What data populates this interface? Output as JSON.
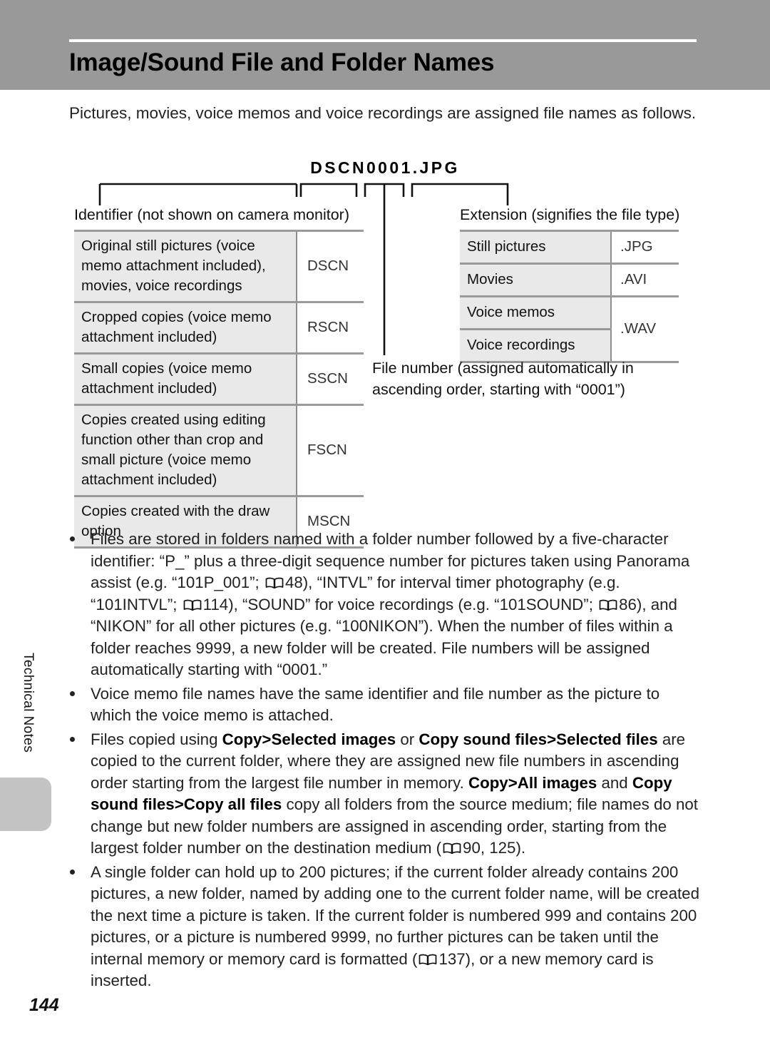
{
  "header": {
    "title": "Image/Sound File and Folder Names"
  },
  "intro": "Pictures, movies, voice memos and voice recordings are assigned file names as follows.",
  "filename_example": "DSCN0001.JPG",
  "captions": {
    "identifier": "Identifier (not shown on camera monitor)",
    "extension": "Extension (signifies the file type)",
    "file_number": "File number (assigned automatically in ascending order, starting with “0001”)"
  },
  "identifier_table": {
    "rows": [
      {
        "desc": "Original still pictures (voice memo attachment included), movies, voice recordings",
        "code": "DSCN"
      },
      {
        "desc": "Cropped copies (voice memo attachment included)",
        "code": "RSCN"
      },
      {
        "desc": "Small copies (voice memo attachment included)",
        "code": "SSCN"
      },
      {
        "desc": "Copies created using editing function other than crop and small picture (voice memo attachment included)",
        "code": "FSCN"
      },
      {
        "desc": "Copies created with the draw option",
        "code": "MSCN"
      }
    ]
  },
  "extension_table": {
    "rows": [
      {
        "desc": "Still pictures",
        "ext": ".JPG"
      },
      {
        "desc": "Movies",
        "ext": ".AVI"
      },
      {
        "desc": "Voice memos",
        "ext": ".WAV"
      },
      {
        "desc": "Voice recordings",
        "ext": ""
      }
    ]
  },
  "notes": {
    "note1": {
      "p1": "Files are stored in folders named with a folder number followed by a five-character identifier: “P_” plus a three-digit sequence number for pictures taken using Panorama assist (e.g. “101P_001”;",
      "ref1": "48",
      "p2": "), “INTVL” for interval timer photography (e.g. “101INTVL”;",
      "ref2": "114",
      "p3": "), “SOUND” for voice recordings (e.g. “101SOUND”;",
      "ref3": "86",
      "p4": "), and “NIKON” for all other pictures (e.g. “100NIKON”). When the number of files within a folder reaches 9999, a new folder will be created. File numbers will be assigned automatically starting with “0001.”"
    },
    "note2": {
      "text": "Voice memo file names have the same identifier and file number as the picture to which the voice memo is attached."
    },
    "note3": {
      "p1": "Files copied using ",
      "b1": "Copy",
      "gt1": ">",
      "b2": "Selected images",
      "p2": " or ",
      "b3": "Copy sound files",
      "gt2": ">",
      "b4": "Selected files",
      "p3": " are copied to the current folder, where they are assigned new file numbers in ascending order starting from the largest file number in memory. ",
      "b5": "Copy",
      "gt3": ">",
      "b6": "All images",
      "p4": " and ",
      "b7": "Copy sound files",
      "gt4": ">",
      "b8": "Copy all files",
      "p5": " copy all folders from the source medium; file names do not change but new folder numbers are assigned in ascending order, starting from the largest folder number on the destination medium (",
      "ref1": "90, 125",
      "p6": ")."
    },
    "note4": {
      "p1": "A single folder can hold up to 200 pictures; if the current folder already contains 200 pictures, a new folder, named by adding one to the current folder name, will be created the next time a picture is taken. If the current folder is numbered 999 and contains 200 pictures, or a picture is numbered 9999, no further pictures can be taken until the internal memory or memory card is formatted (",
      "ref1": "137",
      "p2": "), or a new memory card is inserted."
    }
  },
  "side_label": "Technical Notes",
  "page_number": "144",
  "colors": {
    "header_band": "#999999",
    "cell_shade": "#e9e9e9",
    "rule": "#9a9a9a",
    "tab": "#c4c4c4"
  }
}
